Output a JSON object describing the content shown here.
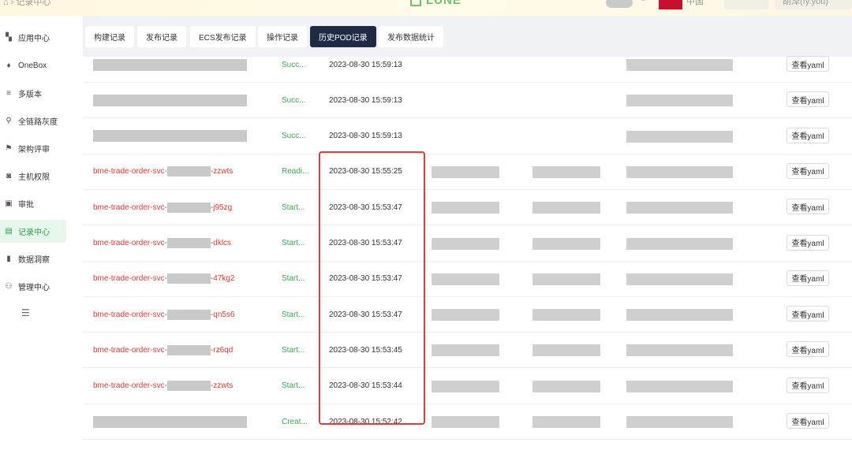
{
  "topbar": {
    "breadcrumb": "记录中心",
    "logo_text": "LUNE",
    "flag_text": "中国",
    "user_text": "胡泽(fy.you)"
  },
  "sidebar": {
    "items": [
      {
        "label": "应用中心",
        "icon": "grid-icon"
      },
      {
        "label": "OneBox",
        "icon": "pin-icon"
      },
      {
        "label": "多版本",
        "icon": "layers-icon"
      },
      {
        "label": "全链路灰度",
        "icon": "branch-icon"
      },
      {
        "label": "架构评审",
        "icon": "review-icon"
      },
      {
        "label": "主机权限",
        "icon": "server-icon"
      },
      {
        "label": "审批",
        "icon": "approve-icon"
      },
      {
        "label": "记录中心",
        "icon": "record-icon",
        "active": true
      },
      {
        "label": "数据洞察",
        "icon": "chart-icon"
      },
      {
        "label": "管理中心",
        "icon": "admin-icon"
      }
    ]
  },
  "tabs": [
    {
      "label": "构建记录"
    },
    {
      "label": "发布记录"
    },
    {
      "label": "ECS发布记录"
    },
    {
      "label": "操作记录"
    },
    {
      "label": "历史POD记录",
      "active": true
    },
    {
      "label": "发布数据统计"
    }
  ],
  "table": {
    "action_label": "查看yaml",
    "rows": [
      {
        "pod_prefix": "",
        "pod_suffix": "",
        "status": "Succ...",
        "time": "2023-08-30 15:59:13"
      },
      {
        "pod_prefix": "",
        "pod_suffix": "",
        "status": "Succ...",
        "time": "2023-08-30 15:59:13"
      },
      {
        "pod_prefix": "",
        "pod_suffix": "",
        "status": "Succ...",
        "time": "2023-08-30 15:59:13"
      },
      {
        "pod_prefix": "bme-trade-order-svc-",
        "pod_suffix": "-zzwts",
        "status": "Readi...",
        "time": "2023-08-30 15:55:25"
      },
      {
        "pod_prefix": "bme-trade-order-svc-",
        "pod_suffix": "-j95zg",
        "status": "Start...",
        "time": "2023-08-30 15:53:47"
      },
      {
        "pod_prefix": "bme-trade-order-svc-",
        "pod_suffix": "-dklcs",
        "status": "Start...",
        "time": "2023-08-30 15:53:47"
      },
      {
        "pod_prefix": "bme-trade-order-svc-",
        "pod_suffix": "-47kg2",
        "status": "Start...",
        "time": "2023-08-30 15:53:47"
      },
      {
        "pod_prefix": "bme-trade-order-svc-",
        "pod_suffix": "-qn5s6",
        "status": "Start...",
        "time": "2023-08-30 15:53:47"
      },
      {
        "pod_prefix": "bme-trade-order-svc-",
        "pod_suffix": "-rz6qd",
        "status": "Start...",
        "time": "2023-08-30 15:53:45"
      },
      {
        "pod_prefix": "bme-trade-order-svc-",
        "pod_suffix": "-zzwts",
        "status": "Start...",
        "time": "2023-08-30 15:53:44"
      },
      {
        "pod_prefix": "",
        "pod_suffix": "",
        "status": "Creat...",
        "time": "2023-08-30 15:52:42"
      }
    ]
  },
  "colors": {
    "accent": "#2e9e4b",
    "pod_name": "#d83a33",
    "status": "#3aa657",
    "active_tab": "#1f2a44",
    "highlight": "#e03a3a"
  }
}
